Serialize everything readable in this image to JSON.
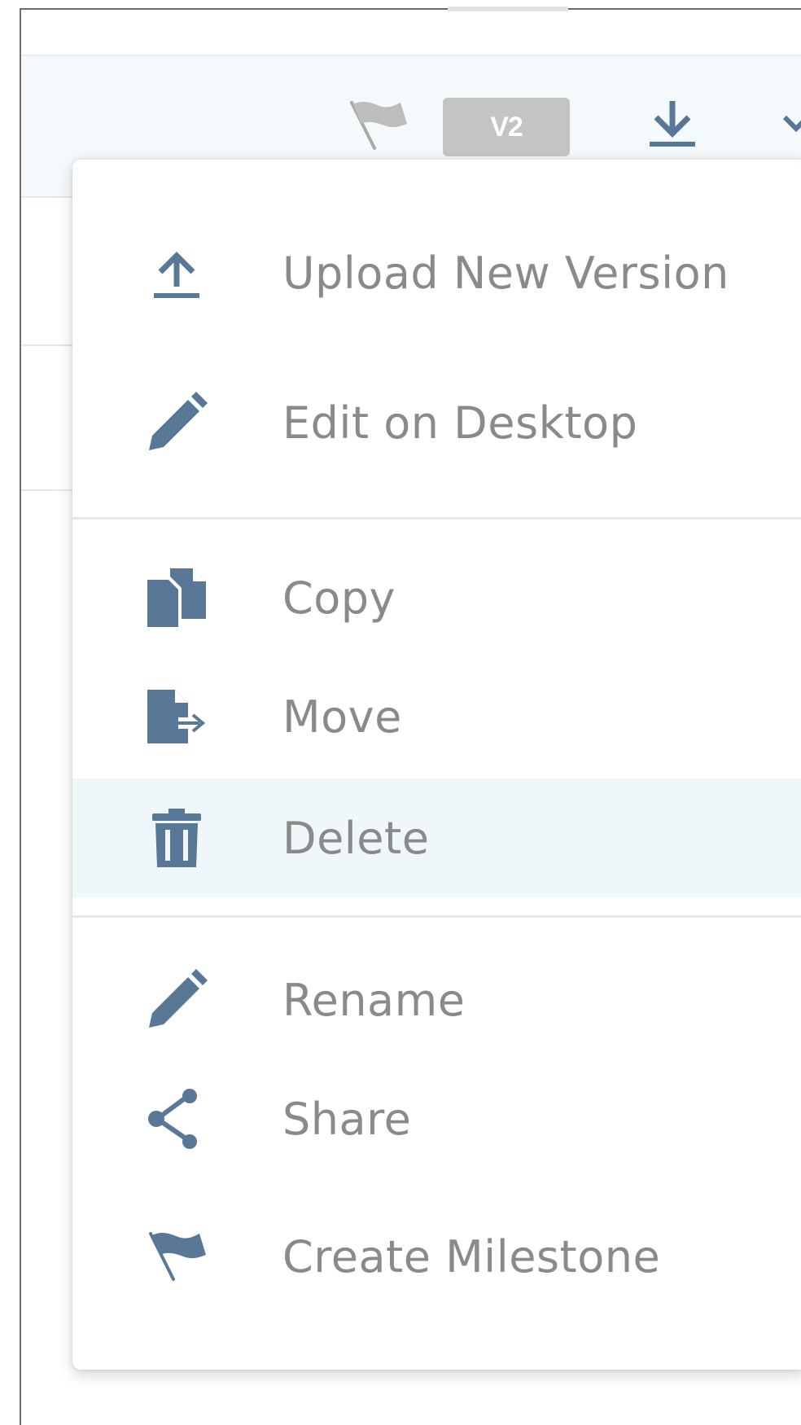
{
  "header": {
    "version_badge": "V2",
    "actions": [
      {
        "name": "milestone-flag",
        "icon": "flag-icon"
      },
      {
        "name": "download",
        "icon": "download-icon"
      },
      {
        "name": "more",
        "icon": "chevron-down-icon"
      }
    ]
  },
  "context_menu": {
    "items": [
      {
        "label": "Upload New Version",
        "icon": "upload-icon"
      },
      {
        "label": "Edit on Desktop",
        "icon": "pencil-icon"
      },
      {
        "label": "Copy",
        "icon": "copy-icon"
      },
      {
        "label": "Move",
        "icon": "move-icon"
      },
      {
        "label": "Delete",
        "icon": "trash-icon",
        "highlighted": true
      },
      {
        "label": "Rename",
        "icon": "pencil-icon"
      },
      {
        "label": "Share",
        "icon": "share-icon"
      },
      {
        "label": "Create Milestone",
        "icon": "flag-icon"
      }
    ]
  },
  "colors": {
    "icon": "#597898",
    "label": "#8a8a8a",
    "highlight": "#eff7fb",
    "badge": "#c4c4c4"
  }
}
